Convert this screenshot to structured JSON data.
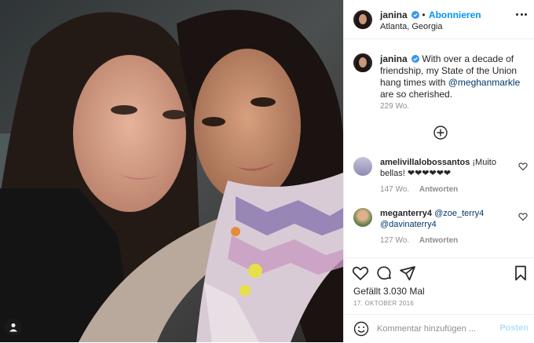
{
  "header": {
    "username": "janina",
    "separator": "•",
    "follow_label": "Abonnieren",
    "location": "Atlanta, Georgia"
  },
  "caption": {
    "username": "janina",
    "text_before": "With over a decade of friendship, my State of the Union hang times with ",
    "mention": "@meghanmarkle",
    "text_after": " are so cherished.",
    "time": "229 Wo."
  },
  "comments": [
    {
      "username": "amelivillalobossantos",
      "text": "¡Muito bellas! ❤❤❤❤❤❤",
      "time": "147 Wo.",
      "reply_label": "Antworten"
    },
    {
      "username": "meganterry4",
      "mention1": "@zoe_terry4",
      "mention2": "@davinaterry4",
      "time": "127 Wo.",
      "reply_label": "Antworten"
    }
  ],
  "stats": {
    "likes": "Gefällt 3.030 Mal",
    "date": "17. Oktober 2016"
  },
  "composer": {
    "placeholder": "Kommentar hinzufügen ...",
    "post_label": "Posten"
  },
  "colors": {
    "accent": "#0095f6",
    "mention": "#00376b",
    "muted": "#8e8e8e",
    "border": "#efefef",
    "post_disabled": "#b2dffc"
  },
  "icons": {
    "verified": "verified-badge-icon",
    "more": "more-options-icon",
    "load_more": "plus-circle-icon",
    "like": "heart-icon",
    "comment": "comment-bubble-icon",
    "share": "paper-plane-icon",
    "save": "bookmark-icon",
    "emoji": "smiley-icon",
    "tagged": "person-icon"
  }
}
